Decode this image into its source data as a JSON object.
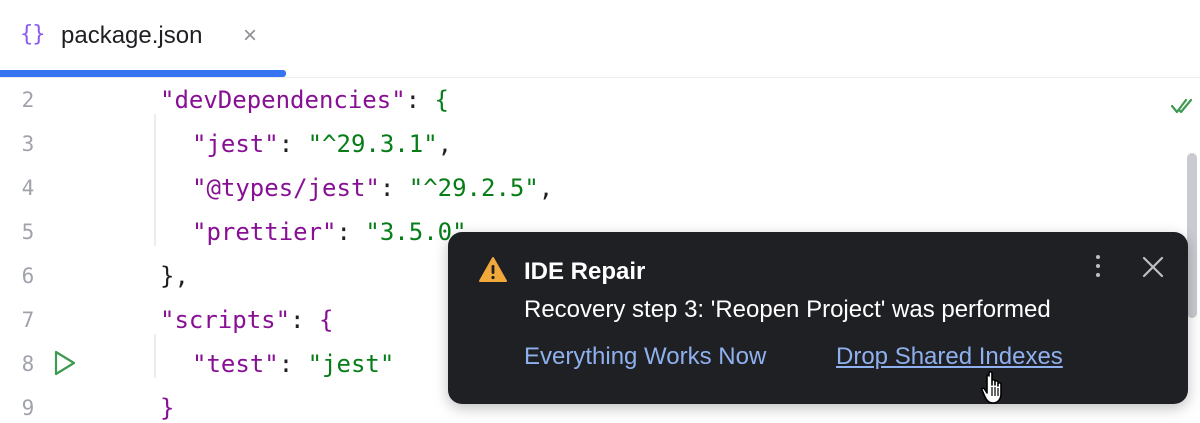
{
  "tab": {
    "icon": "{}",
    "icon_name": "json-braces-icon",
    "label": "package.json",
    "close": "×",
    "accent_color": "#3574f0"
  },
  "editor": {
    "lines": [
      {
        "number": "2"
      },
      {
        "number": "3"
      },
      {
        "number": "4"
      },
      {
        "number": "5"
      },
      {
        "number": "6"
      },
      {
        "number": "7"
      },
      {
        "number": "8"
      },
      {
        "number": "9"
      }
    ],
    "code": {
      "l2": {
        "key": "\"devDependencies\"",
        "colon": ": ",
        "brace": "{"
      },
      "l3": {
        "key": "\"jest\"",
        "colon": ": ",
        "value": "\"^29.3.1\"",
        "comma": ","
      },
      "l4": {
        "key": "\"@types/jest\"",
        "colon": ": ",
        "value": "\"^29.2.5\"",
        "comma": ","
      },
      "l5": {
        "key": "\"prettier\"",
        "colon": ": ",
        "value": "\"3.5.0\""
      },
      "l6": {
        "text": "},"
      },
      "l7": {
        "key": "\"scripts\"",
        "colon": ": ",
        "brace": "{"
      },
      "l8": {
        "key": "\"test\"",
        "colon": ": ",
        "value": "\"jest\""
      },
      "l9": {
        "text": "}"
      }
    }
  },
  "notification": {
    "title": "IDE Repair",
    "message": "Recovery step 3: 'Reopen Project' was performed",
    "actions": [
      "Everything Works Now",
      "Drop Shared Indexes"
    ],
    "icon": "warning-icon",
    "warning_color": "#f2a93b"
  }
}
